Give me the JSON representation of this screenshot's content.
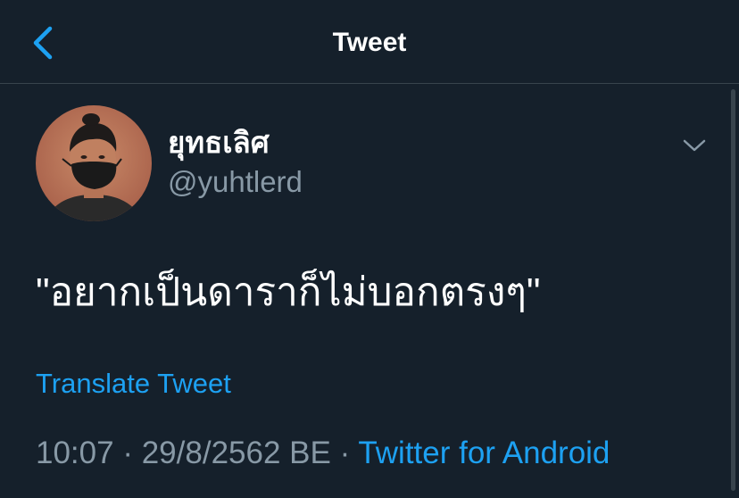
{
  "header": {
    "title": "Tweet",
    "back_icon": "chevron-left-icon"
  },
  "tweet": {
    "author": {
      "display_name": "ยุทธเลิศ",
      "handle": "@yuhtlerd"
    },
    "menu_icon": "chevron-down-icon",
    "text": "\"อยากเป็นดาราก็ไม่บอกตรงๆ\"",
    "translate_label": "Translate Tweet",
    "time": "10:07",
    "separator": "·",
    "date": "29/8/2562 BE",
    "source": "Twitter for Android"
  },
  "colors": {
    "background": "#15202b",
    "accent": "#1da1f2",
    "secondary_text": "#8899a6",
    "divider": "#38444d"
  }
}
